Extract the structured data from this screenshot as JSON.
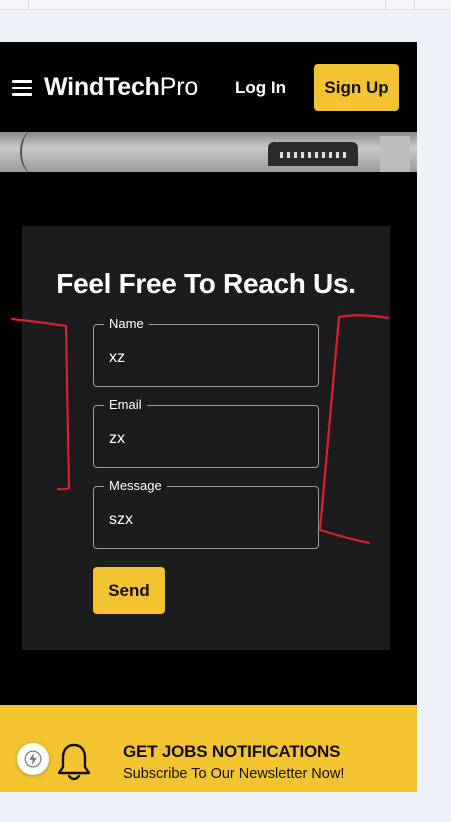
{
  "header": {
    "logo_bold": "WindTech",
    "logo_light": "Pro",
    "login_label": "Log In",
    "signup_label": "Sign Up"
  },
  "contact_form": {
    "title": "Feel Free To Reach Us.",
    "fields": [
      {
        "label": "Name",
        "value": "xz"
      },
      {
        "label": "Email",
        "value": "zx"
      },
      {
        "label": "Message",
        "value": "szx"
      }
    ],
    "send_label": "Send"
  },
  "newsletter": {
    "title": "GET JOBS NOTIFICATIONS",
    "subtitle": "Subscribe To Our Newsletter Now!"
  },
  "colors": {
    "accent": "#f4c430",
    "annotation": "#d9202a",
    "card": "#1c1c1e"
  },
  "icons": [
    "hamburger-icon",
    "bolt-icon",
    "bell-icon"
  ]
}
